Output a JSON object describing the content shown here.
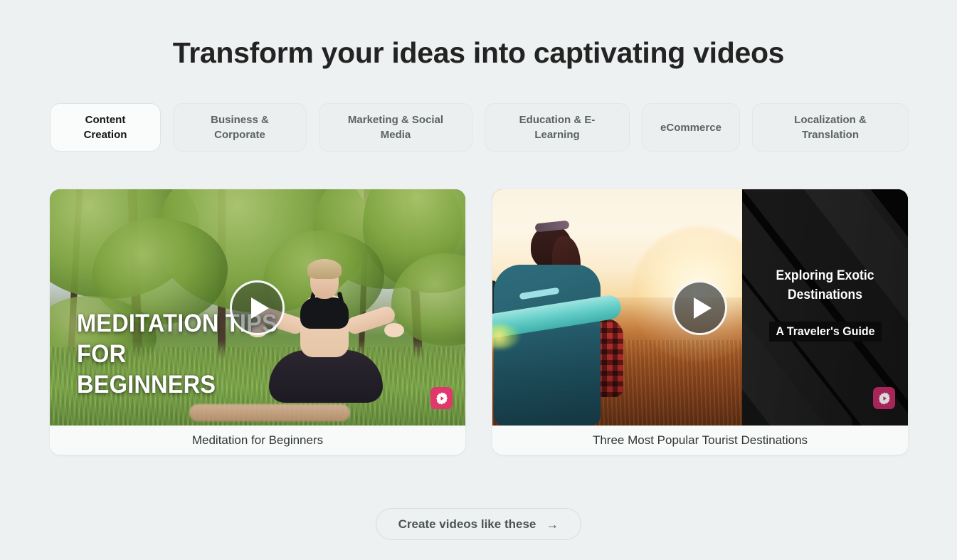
{
  "header": {
    "title": "Transform your ideas into captivating videos"
  },
  "tabs": {
    "items": [
      {
        "label": "Content Creation",
        "active": true
      },
      {
        "label": "Business & Corporate",
        "active": false
      },
      {
        "label": "Marketing & Social Media",
        "active": false
      },
      {
        "label": "Education & E-Learning",
        "active": false
      },
      {
        "label": "eCommerce",
        "active": false
      },
      {
        "label": "Localization & Translation",
        "active": false
      }
    ]
  },
  "cards": [
    {
      "caption": "Meditation for Beginners",
      "overlay_text": "MEDITATION TIPS\nFOR\nBEGINNERS",
      "scene": "woman meditating in lotus pose on a yoga mat in a sunny park",
      "play_icon": "play-icon",
      "badge_icon": "logo-play-badge-icon",
      "badge_color": "#e1376c"
    },
    {
      "caption": "Three Most Popular Tourist Destinations",
      "panel_title": "Exploring Exotic\nDestinations",
      "panel_subtitle": "A Traveler's Guide",
      "scene": "backpacker with teal backpack and rolled mat watching a sunset over fields",
      "play_icon": "play-icon",
      "badge_icon": "logo-play-badge-icon",
      "badge_color": "#a8255a"
    }
  ],
  "cta": {
    "label": "Create videos like these",
    "arrow": "→"
  },
  "colors": {
    "page_background": "#eef1f1",
    "title_text": "#232323",
    "tab_text": "#5c6262",
    "tab_active_text": "#141414",
    "tab_active_background": "#fafbfb",
    "card_background": "#f8faf9",
    "caption_text": "#2f3535",
    "cta_text": "#4e5454",
    "badge_pink": "#e1376c",
    "badge_wine": "#a8255a"
  }
}
